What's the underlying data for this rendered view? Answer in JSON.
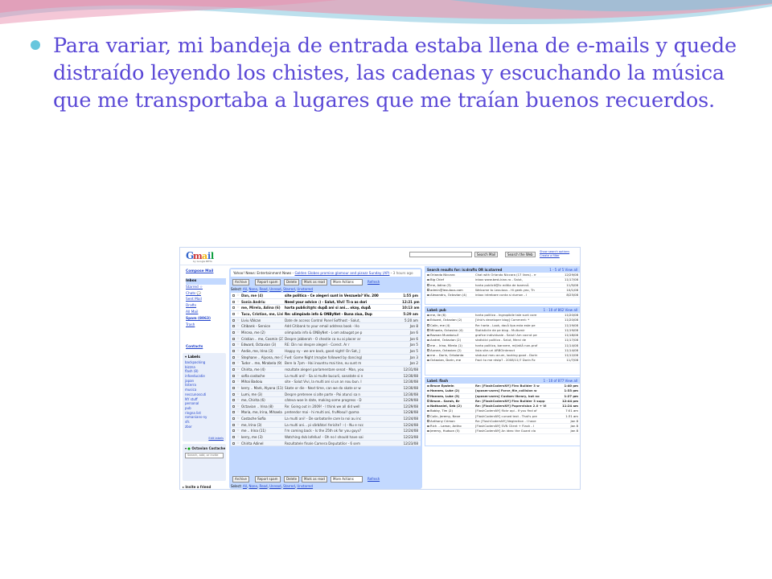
{
  "slide": {
    "text": "Para variar, mi bandeja de entrada estaba llena de e-mails y quede distraído leyendo los chistes, las cadenas y escuchando la música que me transportaba a lugares que me traían buenos recuerdos."
  },
  "colors": {
    "text": "#5a48d6",
    "bullet": "#67c6dd",
    "deco_pink": "#f08aa4",
    "deco_blue": "#9fd3e6",
    "gmail_blue": "#c3d9ff"
  },
  "gmail": {
    "logo": "Gmail",
    "logo_sub": "by Google BETA",
    "search_mail": "Search Mail",
    "search_web": "Search the Web",
    "search_options": [
      "Show search options",
      "Create a filter"
    ],
    "compose": "Compose Mail",
    "nav": [
      {
        "label": "Inbox",
        "selected": true
      },
      {
        "label": "Starred ☆"
      },
      {
        "label": "Chats 💬"
      },
      {
        "label": "Sent Mail"
      },
      {
        "label": "Drafts"
      },
      {
        "label": "All Mail"
      },
      {
        "label": "Spam (8063)"
      },
      {
        "label": "Trash"
      }
    ],
    "contacts": "Contacts",
    "labels_header": "Labels",
    "labels": [
      "backpacking",
      "bizzna",
      "flash (8)",
      "infoeducatie",
      "japan",
      "listerra",
      "musica",
      "neccunoscuti",
      "NY stuff",
      "personal",
      "pub",
      "ringna list",
      "romanians-ny",
      "sfs",
      "zbor"
    ],
    "edit_labels": "Edit labels",
    "chat_user": "Octavian Costache",
    "chat_search": "Search, add, or invite",
    "invite": "Invite a friend",
    "webclip": {
      "source": "Yahoo! News: Entertainment News",
      "link": "Golden Globes promise glamour and pizazz Sunday (AP)",
      "age": "3 hours ago"
    },
    "toolbar": {
      "archive": "Archive",
      "spam": "Report spam",
      "delete": "Delete",
      "mark": "Mark as read",
      "more": "More Actions",
      "refresh": "Refresh"
    },
    "select_prefix": "Select:",
    "select_options": [
      "All",
      "None",
      "Read",
      "Unread",
      "Starred",
      "Unstarred"
    ],
    "messages": [
      {
        "sender": "Dan, me (4)",
        "subject": "site politica - Ce alegeri sunt in Venzuela? Viv. 200",
        "date": "1:55 pm",
        "unread": true
      },
      {
        "sender": "Sonia Andriu",
        "subject": "Need your advice :) - Salut, Vivi! Ti-a as dori",
        "date": "12:21 pm",
        "unread": true
      },
      {
        "sender": "me, Mirela, Adina (6)",
        "subject": "harta publicit@tc dupÄ ani si ani... okay, dupÄ",
        "date": "10:13 am",
        "unread": true
      },
      {
        "sender": "Tucu, Cristian, me, Liviu (4)",
        "subject": "Re: ulimpiada info & ONByNet - Buna ziua, Dup",
        "date": "5:29 am",
        "unread": true
      },
      {
        "sender": "Liviu Vâlcan",
        "subject": "Date de access Control Panel Softhost - Salut,",
        "date": "5:20 am",
        "unread": false
      },
      {
        "sender": "Citibank - Service",
        "subject": "Add Citibank to your email address book - Ho",
        "date": "Jan 8",
        "unread": false
      },
      {
        "sender": "Mircea, me (2)",
        "subject": "olimpiada info & ONByNet - L-am adaugat pe p",
        "date": "Jan 6",
        "unread": false
      },
      {
        "sender": "Cristian .. me, Cosmin (21)",
        "subject": "Despre jabberah - O chestie ca nu ai placer ar",
        "date": "Jan 6",
        "unread": false
      },
      {
        "sender": "Edward, Octavian (3)",
        "subject": "RE: Din noi despre alegeri - Corect. Ar r",
        "date": "Jan 5",
        "unread": false
      },
      {
        "sender": "Andie, me, Irina (3)",
        "subject": "Happy ny - we are back, good night! On Sat, J",
        "date": "Jan 5",
        "unread": false
      },
      {
        "sender": "Stephane .. Alyona, me (10)",
        "subject": "Fwd: Game Night (maybe followed by dancing)",
        "date": "Jan 3",
        "unread": false
      },
      {
        "sender": "Tudor .. me, Mirabela (9)",
        "subject": "Bere la 7pm - Hai insuntru mai tine, eu sunt m",
        "date": "Jan 2",
        "unread": false
      },
      {
        "sender": "Chirita, me (4)",
        "subject": "rezultate alegeri parlamentare senat - Man, you",
        "date": "12/31/08",
        "unread": false
      },
      {
        "sender": "sofia costache",
        "subject": "La multi ani! - Sa ai multe bucurii, sanatate si n",
        "date": "12/30/08",
        "unread": false
      },
      {
        "sender": "Mihai Badoiu",
        "subject": "site - Salut Vivi, la multi ani si un an nou bun. I",
        "date": "12/30/08",
        "unread": false
      },
      {
        "sender": "kerry .. Mark, Alyona (11)",
        "subject": "Skate or die - Next time, can we do skate or w",
        "date": "12/30/08",
        "unread": false
      },
      {
        "sender": "Lumi, me (3)",
        "subject": "Despre pretenee si alte parte - Pai atunci sa n",
        "date": "12/30/08",
        "unread": false
      },
      {
        "sender": "me, Chirita (6)",
        "subject": "câteva woe în date, making some progress - D",
        "date": "12/29/08",
        "unread": false
      },
      {
        "sender": "Octavian .. Irina (8)",
        "subject": "Re: Going out in 2009! - I think we all did well",
        "date": "12/29/08",
        "unread": false
      },
      {
        "sender": "Maria, me, Irina, Mihaela (4)",
        "subject": "pretendor mai - hi multi ani, fruMosul! @oma",
        "date": "12/28/08",
        "unread": false
      },
      {
        "sender": "Costache Sofia",
        "subject": "La multi ani! - De sarbatorile care la noi au inc",
        "date": "12/24/08",
        "unread": false
      },
      {
        "sender": "me, Irina (3)",
        "subject": "La multi ani... pi sãrbãtori fericite? :-) - Nu e ncc",
        "date": "12/24/08",
        "unread": false
      },
      {
        "sender": "me .. Irina (11)",
        "subject": "I'm coming back - Is the 25th ok for you guys?",
        "date": "12/24/08",
        "unread": false
      },
      {
        "sender": "kerry, me (3)",
        "subject": "Watching dvb lafellus! - Oh no I should have sai",
        "date": "12/23/08",
        "unread": false
      },
      {
        "sender": "Chirita Adinel",
        "subject": "Rezultatele finale Camera Deputatilor - 6 sem",
        "date": "12/23/08",
        "unread": false
      }
    ],
    "right_panel_1": {
      "title": "Search results for: is:drafts OR is:starred",
      "count": "1 - 5 of 5  View all",
      "rows": [
        {
          "sender": "Orlando Niccara",
          "subject": "Chat with Orlando Niccara (17 lines) - rr",
          "date": "12/29/08"
        },
        {
          "sender": "Big Chief",
          "subject": "inbox  www.best-kian.ro - Salut,",
          "date": "11/17/08"
        },
        {
          "sender": "me, Adina (3)",
          "subject": "harta publicit@tc editia de toamnÄ",
          "date": "11/5/08"
        },
        {
          "sender": "admin@lexulous.com",
          "subject": "Welcome to Lexulous - Hi geek.yeo, Th",
          "date": "10/1/08"
        },
        {
          "sender": "Alexandru, Octavian (4)",
          "subject": "inbox  intrebare conta si dumon - I",
          "date": "8/25/08"
        }
      ]
    },
    "right_panel_2": {
      "title": "Label: pub",
      "count": "1 - 10 of 862  View all",
      "rows": [
        {
          "sender": "me, Ile (6)",
          "subject": "harta politica - Ingropibile tale sunt core",
          "date": "11/20/08"
        },
        {
          "sender": "Eduard, Octavian (2)",
          "subject": "[Vnb's developer blog] Comment: *",
          "date": "11/20/08"
        },
        {
          "sender": "Calin, me (4)",
          "subject": "Re: harta - Look, dacÄ lipa esta este pe",
          "date": "11/19/08"
        },
        {
          "sender": "Mihaela, Octavian (4)",
          "subject": "Statisticile de pe blog - Multumir",
          "date": "11/19/08"
        },
        {
          "sender": "Razvan Muratoiu-E",
          "subject": "grafice individuale - Salut! Am cocrut pe",
          "date": "11/18/08"
        },
        {
          "sender": "Andrei, Octavian (2)",
          "subject": "statistici politica - Salut, Merci de",
          "date": "11/17/08"
        },
        {
          "sender": "me .. Irina, Mirela (1)",
          "subject": "harta politica, bannere, mijlatiÄ non-prof",
          "date": "11/14/08"
        },
        {
          "sender": "Aurora, Octavian (2)",
          "subject": "lista site-uri ARBOinteract",
          "date": "11/14/08"
        },
        {
          "sender": "me .. Dorin, Ortolanta",
          "subject": "statusul meu acum, looking good - Dorin",
          "date": "11/12/08"
        },
        {
          "sender": "Octavian, Dorin, me",
          "subject": "Fwd: to me ntstp? - 2008/11/7 Dorin Rc",
          "date": "11/7/08"
        }
      ]
    },
    "right_panel_3": {
      "title": "Label: flash",
      "count": "1 - 10 of 877  View all",
      "rows": [
        {
          "sender": "Bruce Epstein",
          "subject": "Re: [FlashCodersNY] Flex Builder 3 w",
          "date": "1:40 pm",
          "unread": true
        },
        {
          "sender": "Hannes, Luke (2)",
          "subject": "[sposm-users] Force_file_collision w",
          "date": "1:33 pm",
          "unread": true
        },
        {
          "sender": "Hannes, Luke (3)",
          "subject": "[sposm-users] Custom library, but no",
          "date": "1:27 pm",
          "unread": true
        },
        {
          "sender": "Bruce.. Sarah, Br",
          "subject": "Re: [FlashCodersNY] Flex Builder 3 supp",
          "date": "12:44 pm",
          "unread": true
        },
        {
          "sender": "Nathaniel, Seb (2)",
          "subject": "Re: [FlashCodersNY] Papervision 2.0 + Vi",
          "date": "11:24 am",
          "unread": true
        },
        {
          "sender": "Bobby, Tim (2)",
          "subject": "[FlashCodersNY] flickr api - If you find of",
          "date": "7:01 am",
          "unread": false
        },
        {
          "sender": "Colin, Jeremy, Neve",
          "subject": "[FlashCodersNY] cursed text - That's pre",
          "date": "1:31 am",
          "unread": false
        },
        {
          "sender": "Anthony Crimon",
          "subject": "Re: [FlashCodersNY] Neglection - I have",
          "date": "Jan 8",
          "unread": false
        },
        {
          "sender": "Rich .. Lamar, Antho",
          "subject": "[FlashCodersNY] SVN Client + Flash - I",
          "date": "Jan 8",
          "unread": false
        },
        {
          "sender": "Jeremy, Hudson (5)",
          "subject": "[FlashCodersNY] An idea: the Guard cla",
          "date": "Jan 8",
          "unread": false
        }
      ]
    }
  }
}
